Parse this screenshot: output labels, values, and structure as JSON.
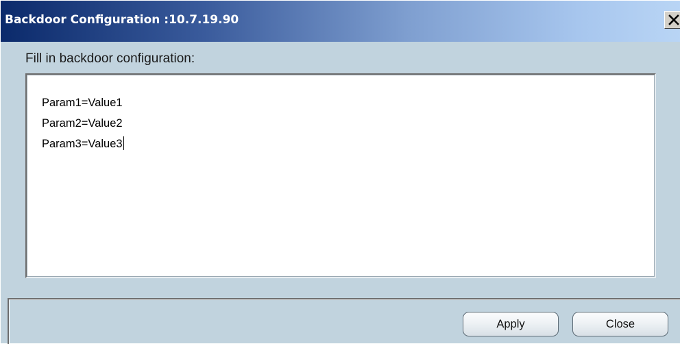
{
  "window": {
    "title": "Backdoor Configuration :10.7.19.90",
    "close_label": "X"
  },
  "form": {
    "prompt": "Fill in backdoor configuration:",
    "lines": [
      "Param1=Value1",
      "Param2=Value2",
      "Param3=Value3"
    ]
  },
  "buttons": {
    "apply_label": "Apply",
    "close_label": "Close"
  },
  "colors": {
    "title_gradient_start": "#0b2a6b",
    "title_gradient_end": "#b9d5f5",
    "window_bg": "#c1d3de"
  }
}
